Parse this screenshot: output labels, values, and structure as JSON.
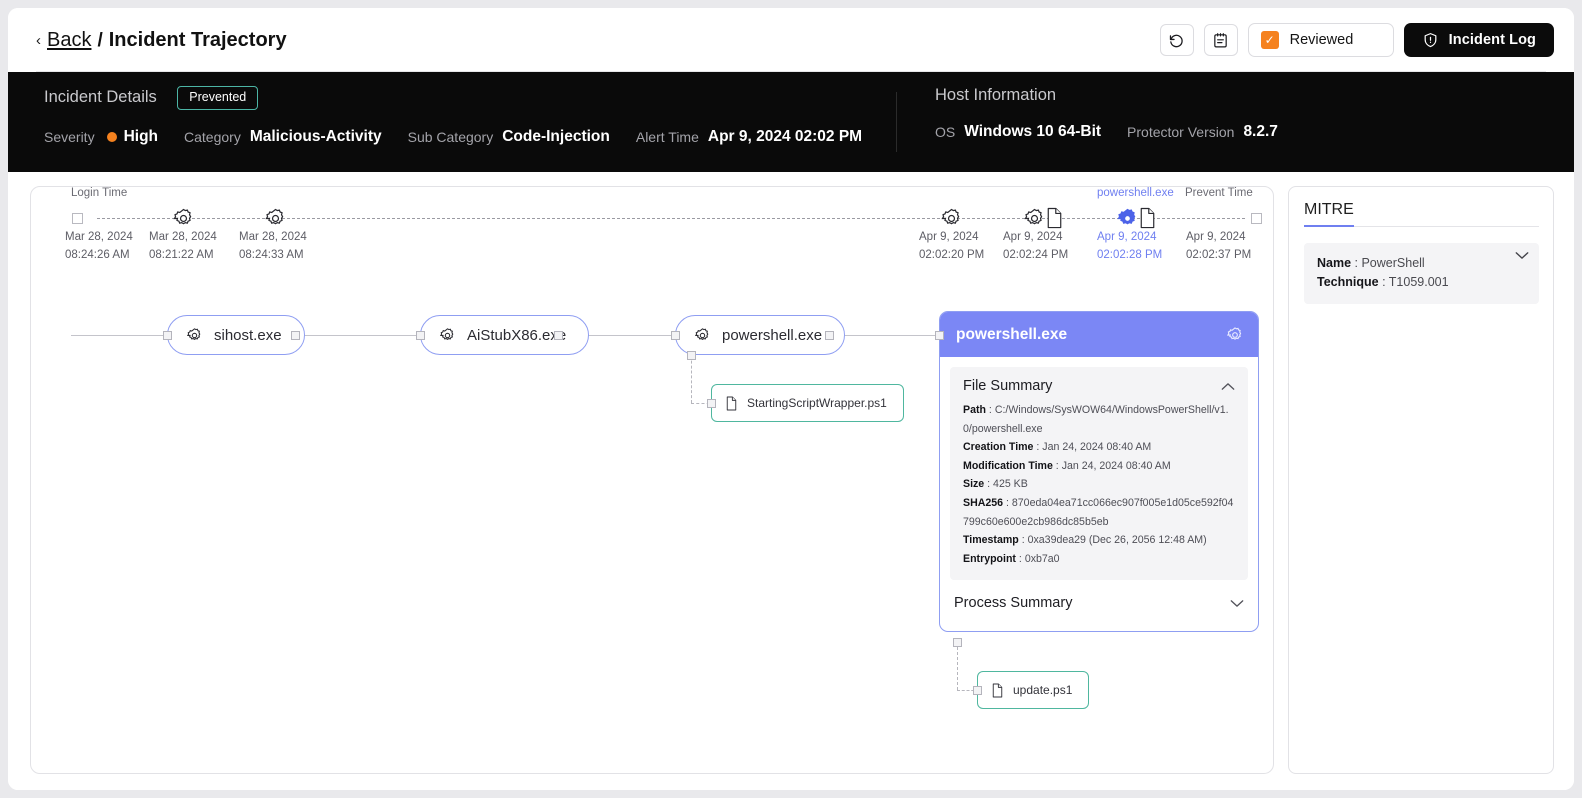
{
  "header": {
    "chevron": "‹",
    "back_label": "Back",
    "separator": "/",
    "page_title": "Incident Trajectory",
    "undo_icon": "undo-icon",
    "notes_icon": "clipboard-icon",
    "reviewed_label": "Reviewed",
    "reviewed_check": "✓",
    "reviewed_accent": "#f5821f",
    "incident_log_label": "Incident Log",
    "incident_log_icon": "shield-alert-icon"
  },
  "incident": {
    "section_title": "Incident Details",
    "status_badge": "Prevented",
    "status_badge_color": "#4cb5a5",
    "severity_key": "Severity",
    "severity_value": "High",
    "severity_color": "#f5821f",
    "category_key": "Category",
    "category_value": "Malicious-Activity",
    "sub_category_key": "Sub Category",
    "sub_category_value": "Code-Injection",
    "alert_time_key": "Alert Time",
    "alert_time_value": "Apr 9, 2024 02:02 PM"
  },
  "host": {
    "section_title": "Host Information",
    "os_key": "OS",
    "os_value": "Windows 10 64-Bit",
    "protector_key": "Protector Version",
    "protector_value": "8.2.7"
  },
  "timeline": {
    "start_label": "Login Time",
    "end_label": "Prevent Time",
    "highlight_label": "powershell.exe",
    "accent_color": "#6f7ff0",
    "events": [
      {
        "date": "Mar 28, 2024",
        "time": "08:24:26 AM",
        "marker": "endcap"
      },
      {
        "date": "Mar 28, 2024",
        "time": "08:21:22 AM",
        "marker": "gear"
      },
      {
        "date": "Mar 28, 2024",
        "time": "08:24:33 AM",
        "marker": "gear"
      },
      {
        "date": "Apr 9, 2024",
        "time": "02:02:20 PM",
        "marker": "gear"
      },
      {
        "date": "Apr 9, 2024",
        "time": "02:02:24 PM",
        "marker": "gear-file"
      },
      {
        "date": "Apr 9, 2024",
        "time": "02:02:28 PM",
        "marker": "gear-file-active"
      },
      {
        "date": "Apr 9, 2024",
        "time": "02:02:37 PM",
        "marker": "endcap"
      }
    ]
  },
  "graph": {
    "processes": [
      {
        "name": "sihost.exe",
        "icon": "gear-icon"
      },
      {
        "name": "AiStubX86.exe",
        "icon": "gear-icon"
      },
      {
        "name": "powershell.exe",
        "icon": "gear-icon"
      }
    ],
    "files": [
      {
        "name": "StartingScriptWrapper.ps1",
        "icon": "file-icon"
      },
      {
        "name": "update.ps1",
        "icon": "file-icon"
      }
    ]
  },
  "detail_card": {
    "title": "powershell.exe",
    "gear_icon": "gear-icon",
    "header_color": "#7b87f5",
    "file_summary": {
      "heading": "File Summary",
      "collapse_icon": "chevron-up-icon",
      "rows": [
        {
          "key": "Path",
          "value": "C:/Windows/SysWOW64/WindowsPowerShell/v1.0/powershell.exe"
        },
        {
          "key": "Creation Time",
          "value": "Jan 24, 2024 08:40 AM"
        },
        {
          "key": "Modification Time",
          "value": "Jan 24, 2024 08:40 AM"
        },
        {
          "key": "Size",
          "value": "425 KB"
        },
        {
          "key": "SHA256",
          "value": "870eda04ea71cc066ec907f005e1d05ce592f04799c60e600e2cb986dc85b5eb"
        },
        {
          "key": "Timestamp",
          "value": "0xa39dea29 (Dec 26, 2056 12:48 AM)"
        },
        {
          "key": "Entrypoint",
          "value": "0xb7a0"
        }
      ]
    },
    "process_summary": {
      "heading": "Process Summary",
      "expand_icon": "chevron-down-icon"
    }
  },
  "mitre": {
    "title": "MITRE",
    "expand_icon": "chevron-down-icon",
    "name_key": "Name",
    "name_value": "PowerShell",
    "technique_key": "Technique",
    "technique_value": "T1059.001"
  }
}
